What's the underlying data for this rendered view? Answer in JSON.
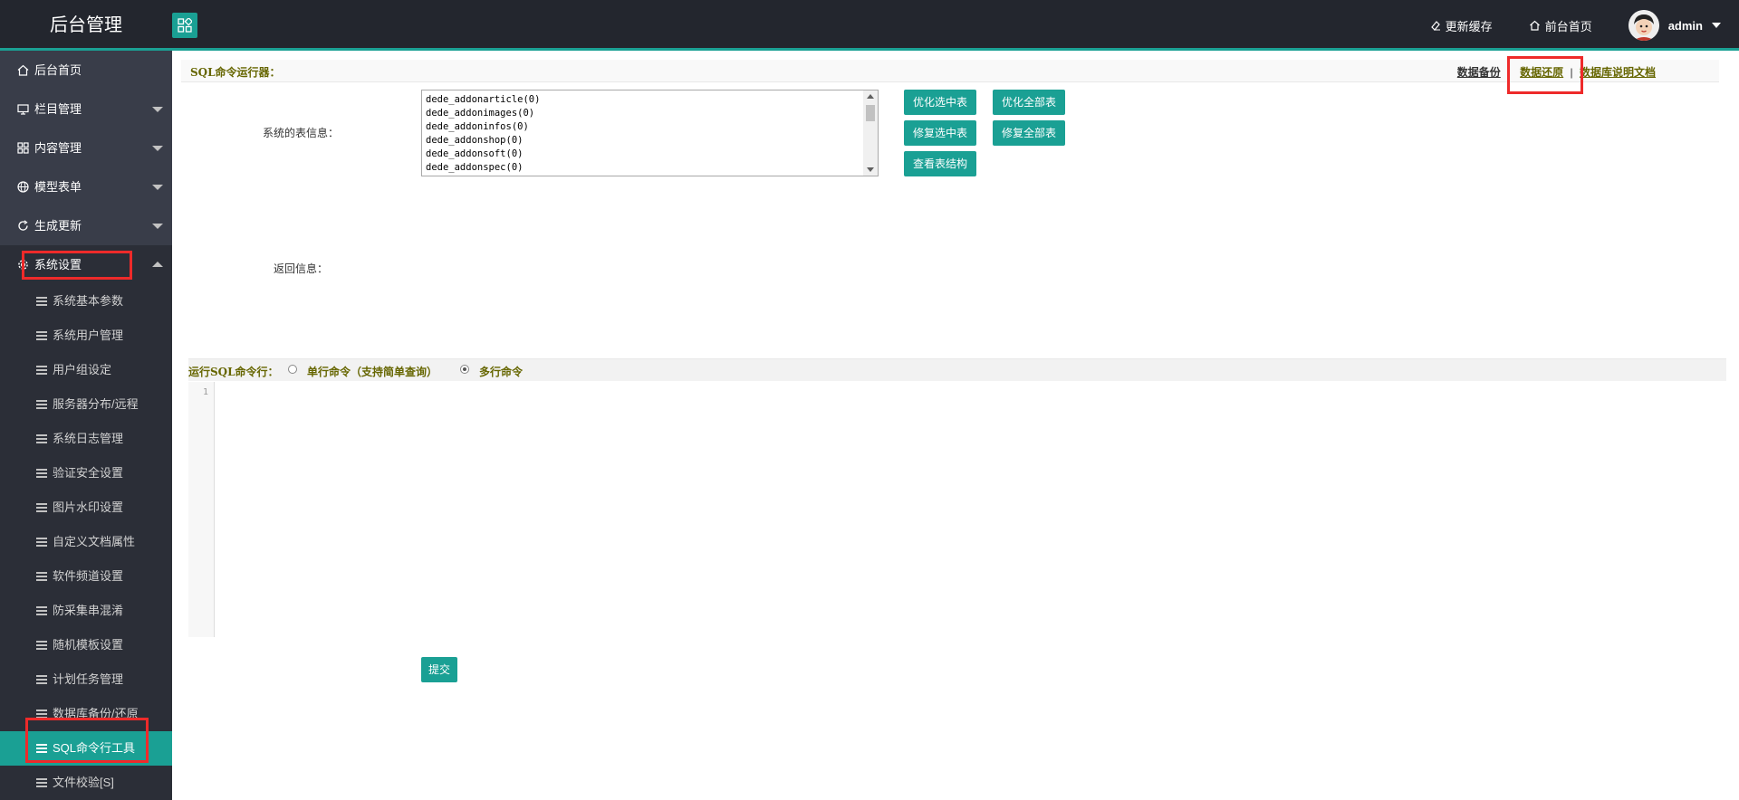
{
  "app": {
    "title": "后台管理"
  },
  "topbar": {
    "update_cache": "更新缓存",
    "frontend_home": "前台首页",
    "user": "admin"
  },
  "sidebar": {
    "items": [
      {
        "label": "后台首页",
        "icon": "home-icon"
      },
      {
        "label": "栏目管理",
        "icon": "monitor-icon"
      },
      {
        "label": "内容管理",
        "icon": "grid-icon"
      },
      {
        "label": "模型表单",
        "icon": "globe-icon"
      },
      {
        "label": "生成更新",
        "icon": "refresh-icon"
      },
      {
        "label": "系统设置",
        "icon": "gear-icon"
      }
    ],
    "sub_items": [
      "系统基本参数",
      "系统用户管理",
      "用户组设定",
      "服务器分布/远程",
      "系统日志管理",
      "验证安全设置",
      "图片水印设置",
      "自定义文档属性",
      "软件频道设置",
      "防采集串混淆",
      "随机模板设置",
      "计划任务管理",
      "数据库备份/还原",
      "SQL命令行工具",
      "文件校验[S]"
    ],
    "active_sub": "SQL命令行工具"
  },
  "main": {
    "header_title": "SQL命令运行器：",
    "links": {
      "backup": "数据备份",
      "restore": "数据还原",
      "sep": "|",
      "docs": "数据库说明文档"
    },
    "table_info_label": "系统的表信息：",
    "tables": [
      "dede_addonarticle(0)",
      "dede_addonimages(0)",
      "dede_addoninfos(0)",
      "dede_addonshop(0)",
      "dede_addonsoft(0)",
      "dede_addonspec(0)"
    ],
    "buttons": {
      "optimize_selected": "优化选中表",
      "optimize_all": "优化全部表",
      "repair_selected": "修复选中表",
      "repair_all": "修复全部表",
      "view_structure": "查看表结构"
    },
    "return_label": "返回信息：",
    "run_label": "运行SQL命令行：",
    "single_line": "单行命令（支持简单查询）",
    "multi_line": "多行命令",
    "line_number": "1",
    "submit": "提交"
  },
  "colors": {
    "accent": "#1aa094",
    "topbar": "#23262e",
    "sidebar": "#393d49",
    "highlight": "#ee2a2a",
    "olive": "#666600"
  }
}
